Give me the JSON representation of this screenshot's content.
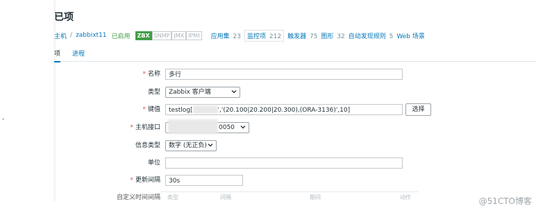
{
  "header": {
    "title": "已项"
  },
  "breadcrumb": {
    "host_prefix": "主机",
    "sep": "/",
    "host": "zabbixt11",
    "status": "已启用",
    "tags": [
      "ZBX",
      "SNMP",
      "JMX",
      "IPMI"
    ],
    "links": [
      {
        "label": "应用集",
        "count": "23"
      },
      {
        "label": "监控项",
        "count": "212"
      },
      {
        "label": "触发器",
        "count": "75"
      },
      {
        "label": "图形",
        "count": "32"
      },
      {
        "label": "自动发现规则",
        "count": "5"
      },
      {
        "label": "Web 场景",
        "count": ""
      }
    ]
  },
  "tabs": [
    "项",
    "进程"
  ],
  "form": {
    "name": {
      "label": "名称",
      "value": "多行"
    },
    "type": {
      "label": "类型",
      "value": "Zabbix 客户端"
    },
    "key": {
      "label": "键值",
      "value_prefix": "testlog[",
      "value_suffix": "','(20.100|20.200|20.300),(ORA-3136)',10]",
      "select_button": "选择"
    },
    "interface": {
      "label": "主机接口",
      "value_suffix": "0050"
    },
    "info_type": {
      "label": "信息类型",
      "value": "数字 (无正负)"
    },
    "unit": {
      "label": "单位",
      "value": ""
    },
    "update_interval": {
      "label": "更新间隔",
      "value": "30s"
    },
    "custom_intervals": {
      "label": "自定义时间间隔",
      "columns": [
        "类型",
        "间隔",
        "期间",
        "动作"
      ]
    }
  },
  "watermark": "@51CTO博客",
  "colors": {
    "link": "#0275b8",
    "enabled": "#429e47",
    "required": "#d64e4e"
  }
}
